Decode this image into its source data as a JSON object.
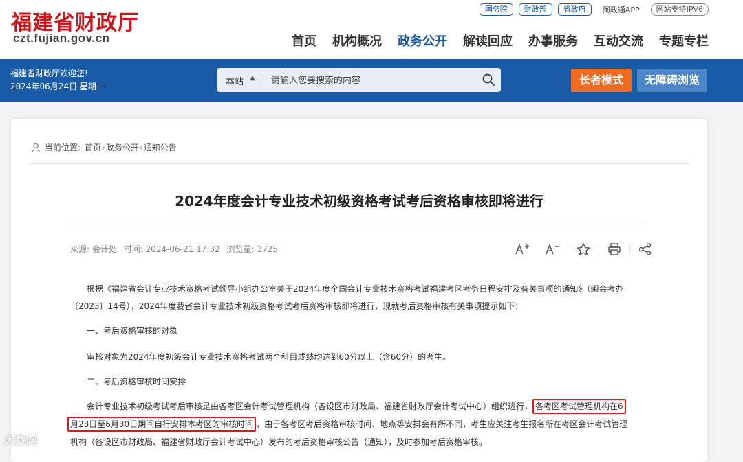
{
  "header": {
    "logo_cn": "福建省财政厅",
    "logo_en": "czt.fujian.gov.cn",
    "top_links": [
      "国务院",
      "财政部",
      "省政府"
    ],
    "app_link": "闽政通APP",
    "ipv6": "网站支持IPV6",
    "nav": [
      "首页",
      "机构概况",
      "政务公开",
      "解读回应",
      "办事服务",
      "互动交流",
      "专题专栏"
    ],
    "active_nav": "政务公开"
  },
  "banner": {
    "welcome": "福建省财政厅欢迎您!",
    "date": "2024年06月24日 星期一",
    "search_scope": "本站",
    "search_placeholder": "请输入您要搜索的内容",
    "elder_mode": "长者模式",
    "accessibility": "无障碍浏览"
  },
  "breadcrumb": {
    "label": "当前位置:",
    "items": [
      "首页",
      "政务公开",
      "通知公告"
    ]
  },
  "article": {
    "title": "2024年度会计专业技术初级资格考试考后资格审核即将进行",
    "source": "来源: 会计处",
    "time": "时间: 2024-06-21 17:32",
    "views": "浏览量: 2725",
    "paragraphs": {
      "p1a": "根据《福建省会计专业技术资格考试领导小组办公室关于2024年度全国会计专业技术资格考试福建考区考务日程安排及有关事项的通知》（闽会考办",
      "p1b": "〔2023〕14号），2024年度我省会计专业技术初级资格考试考后资格审核即将进行，现就考后资格审核有关事项提示如下：",
      "h1": "一、考后资格审核的对象",
      "p2": "审核对象为2024年度初级会计专业技术资格考试两个科目成绩均达到60分以上（含60分）的考生。",
      "h2": "二、考后资格审核时间安排",
      "p3a_pre": "会计专业技术初级考试考后审核是由各考区会计考试管理机构（各设区市财政局、福建省财政厅会计考试中心）组织进行，",
      "p3a_hl": "各考区考试管理机构在6",
      "p3b_hl": "月23日至6月30日期间自行安排本考区的审核时间",
      "p3b_post": "，由于各考区考后资格审核时间、地点等安排会有所不同，考生应关注考生报名所在考区会计考试管理",
      "p3c": "机构（各设区市财政局、福建省财政厅会计考试中心）发布的考后资格审核公告（通知），及时参加考后资格审核。"
    }
  },
  "watermark": "大数网"
}
